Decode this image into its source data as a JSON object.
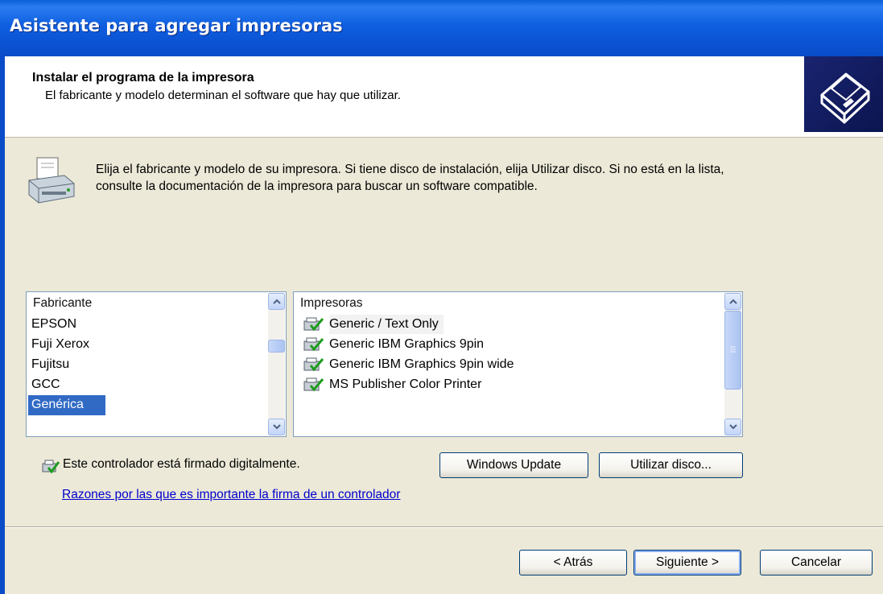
{
  "window": {
    "title": "Asistente para agregar impresoras"
  },
  "header": {
    "title": "Instalar el programa de la impresora",
    "subtitle": "El fabricante y modelo determinan el software que hay que utilizar."
  },
  "intro": {
    "text": "Elija el fabricante y modelo de su impresora. Si tiene disco de instalación, elija Utilizar disco. Si no está en la lista, consulte la documentación de la impresora para buscar un software compatible."
  },
  "manufacturers": {
    "header": "Fabricante",
    "items": [
      "EPSON",
      "Fuji Xerox",
      "Fujitsu",
      "GCC",
      "Genérica"
    ],
    "selected": "Genérica"
  },
  "printers": {
    "header": "Impresoras",
    "items": [
      "Generic / Text Only",
      "Generic IBM Graphics 9pin",
      "Generic IBM Graphics 9pin wide",
      "MS Publisher Color Printer"
    ]
  },
  "signed": {
    "text": "Este controlador está firmado digitalmente."
  },
  "link": {
    "text": "Razones por las que es importante la firma de un controlador"
  },
  "buttons": {
    "windows_update": "Windows Update",
    "have_disk": "Utilizar disco...",
    "back": "< Atrás",
    "next": "Siguiente >",
    "cancel": "Cancelar"
  },
  "colors": {
    "titlebar": "#0a55d6",
    "dialog_bg": "#ece9d8",
    "selection": "#316ac5",
    "link": "#0000cc"
  }
}
